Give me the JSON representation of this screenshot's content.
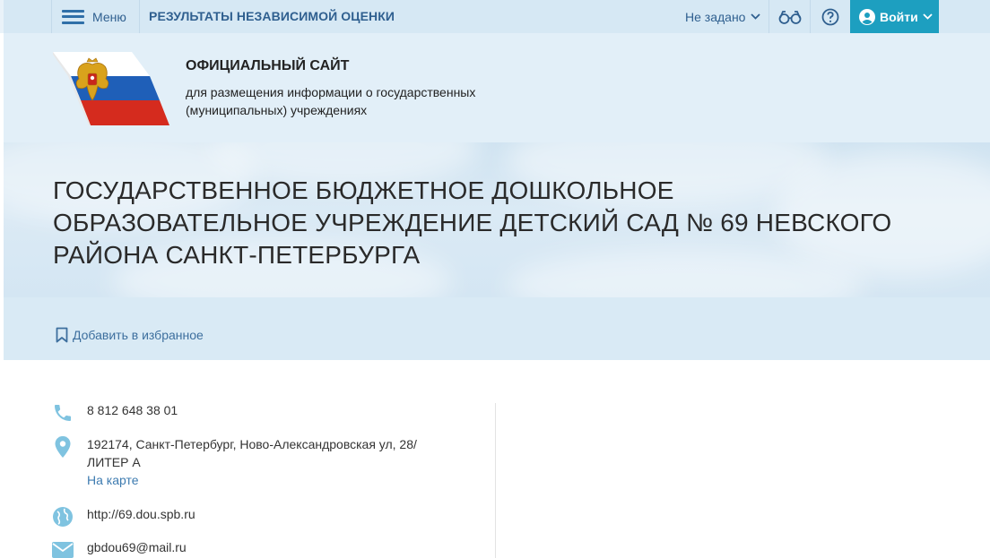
{
  "topnav": {
    "menu_label": "Меню",
    "title": "РЕЗУЛЬТАТЫ НЕЗАВИСИМОЙ ОЦЕНКИ",
    "region": "Не задано",
    "login_label": "Войти",
    "icons": [
      "burger-menu-icon",
      "chevron-down-icon",
      "glasses-icon",
      "help-icon",
      "user-icon"
    ]
  },
  "header": {
    "site_title": "ОФИЦИАЛЬНЫЙ САЙТ",
    "site_subtitle": "для размещения информации о государственных (муниципальных) учреждениях"
  },
  "organization": {
    "name": "ГОСУДАРСТВЕННОЕ БЮДЖЕТНОЕ ДОШКОЛЬНОЕ ОБРАЗОВАТЕЛЬНОЕ УЧРЕЖДЕНИЕ ДЕТСКИЙ САД № 69 НЕВСКОГО РАЙОНА САНКТ-ПЕТЕРБУРГА",
    "favorite_label": "Добавить в избранное"
  },
  "contacts": {
    "phone": "8 812 648 38 01",
    "address_line1": "192174, Санкт-Петербург, Ново-Александровская ул, 28/",
    "address_line2": "ЛИТЕР А",
    "map_link": "На карте",
    "website": "http://69.dou.spb.ru",
    "email": "gbdou69@mail.ru"
  },
  "colors": {
    "accent": "#1d9fc0",
    "nav_bg": "#d6e8f4",
    "header_bg": "#e2eff8",
    "link": "#3d7bb0",
    "icon": "#7fc3e0"
  }
}
